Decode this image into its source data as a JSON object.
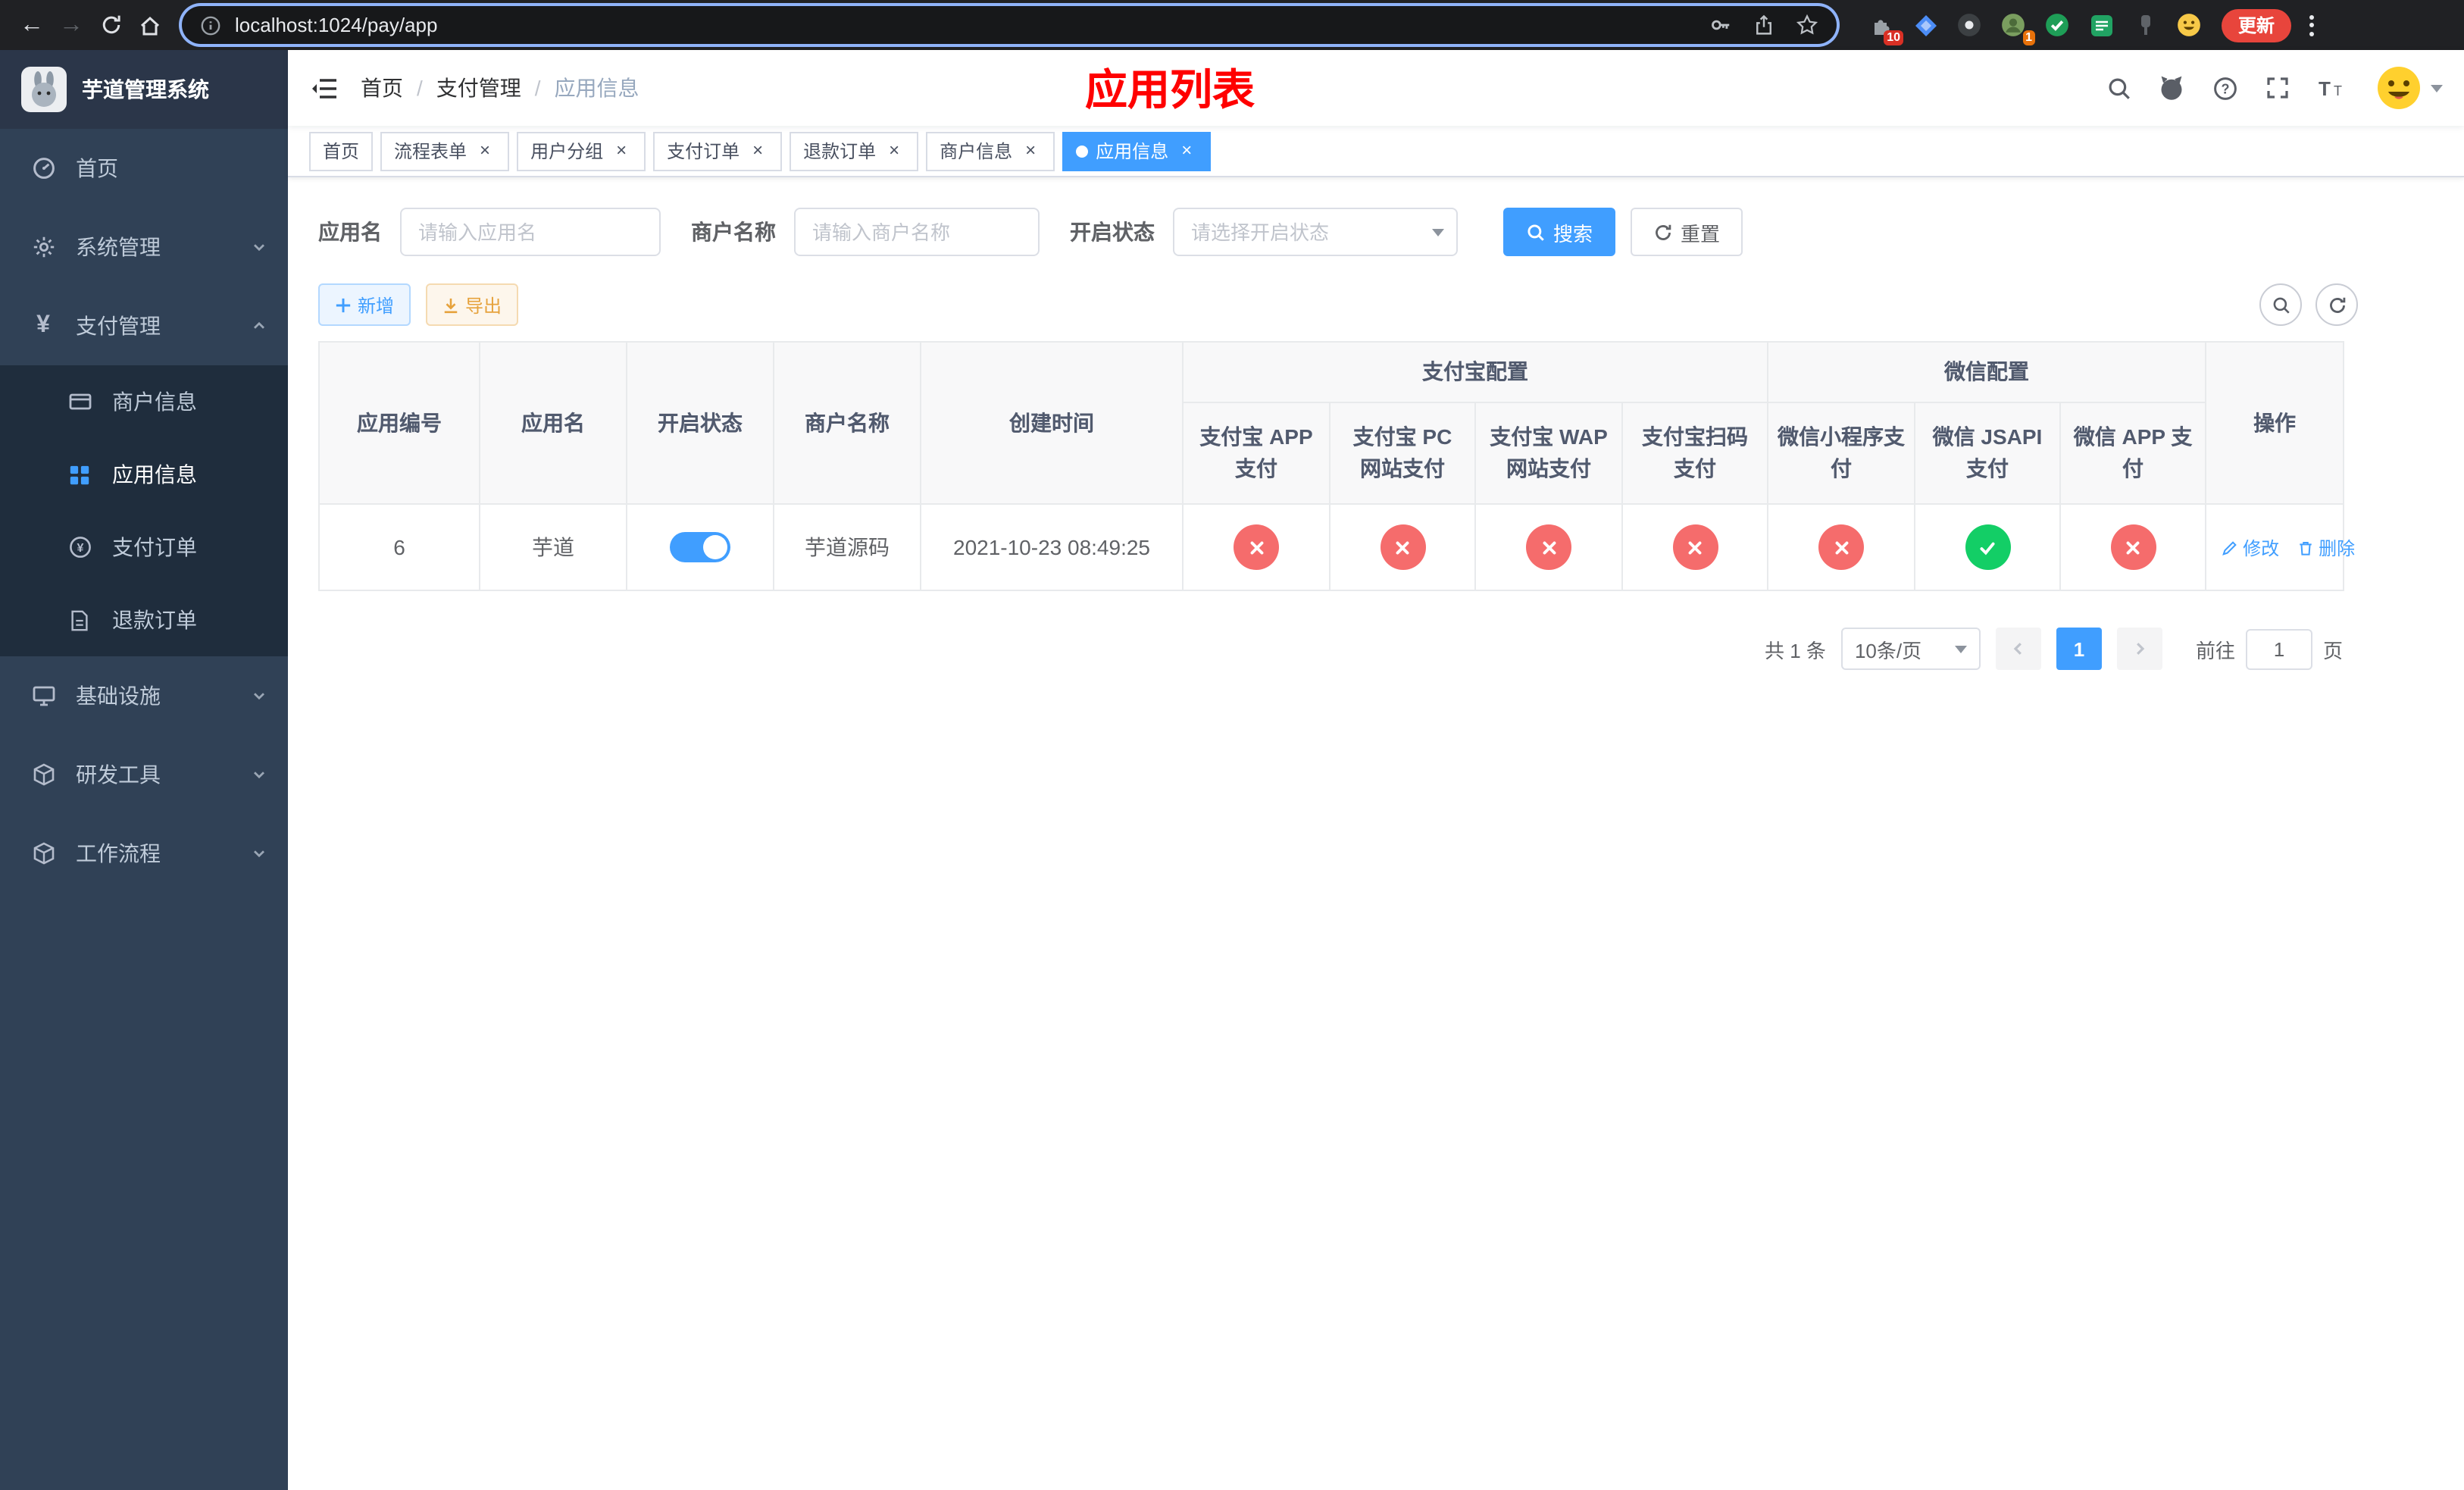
{
  "browser": {
    "url": "localhost:1024/pay/app",
    "update_label": "更新",
    "extensions_badge": "10",
    "profile_badge": "1"
  },
  "sidebar": {
    "title": "芋道管理系统",
    "menu": [
      {
        "label": "首页"
      },
      {
        "label": "系统管理"
      },
      {
        "label": "支付管理"
      },
      {
        "label": "基础设施"
      },
      {
        "label": "研发工具"
      },
      {
        "label": "工作流程"
      }
    ],
    "submenu": [
      {
        "label": "商户信息"
      },
      {
        "label": "应用信息",
        "active": true
      },
      {
        "label": "支付订单"
      },
      {
        "label": "退款订单"
      }
    ]
  },
  "header": {
    "breadcrumb": [
      "首页",
      "支付管理",
      "应用信息"
    ],
    "page_title": "应用列表"
  },
  "tabs": [
    {
      "label": "首页"
    },
    {
      "label": "流程表单"
    },
    {
      "label": "用户分组"
    },
    {
      "label": "支付订单"
    },
    {
      "label": "退款订单"
    },
    {
      "label": "商户信息"
    },
    {
      "label": "应用信息"
    }
  ],
  "filters": {
    "app_name_label": "应用名",
    "app_name_placeholder": "请输入应用名",
    "merchant_label": "商户名称",
    "merchant_placeholder": "请输入商户名称",
    "status_label": "开启状态",
    "status_placeholder": "请选择开启状态",
    "search_label": "搜索",
    "reset_label": "重置"
  },
  "toolbar": {
    "add_label": "新增",
    "export_label": "导出"
  },
  "table": {
    "headers": {
      "app_id": "应用编号",
      "app_name": "应用名",
      "status": "开启状态",
      "merchant": "商户名称",
      "created": "创建时间",
      "alipay_group": "支付宝配置",
      "wechat_group": "微信配置",
      "alipay_app": "支付宝 APP 支付",
      "alipay_pc": "支付宝 PC 网站支付",
      "alipay_wap": "支付宝 WAP 网站支付",
      "alipay_scan": "支付宝扫码支付",
      "wechat_mini": "微信小程序支付",
      "wechat_jsapi": "微信 JSAPI 支付",
      "wechat_app": "微信 APP 支付",
      "actions": "操作"
    },
    "rows": [
      {
        "app_id": "6",
        "app_name": "芋道",
        "status": "on",
        "merchant": "芋道源码",
        "created": "2021-10-23 08:49:25",
        "alipay_app": "disabled",
        "alipay_pc": "disabled",
        "alipay_wap": "disabled",
        "alipay_scan": "disabled",
        "wechat_mini": "disabled",
        "wechat_jsapi": "enabled",
        "wechat_app": "disabled",
        "edit_label": "修改",
        "delete_label": "删除"
      }
    ]
  },
  "pagination": {
    "total_label": "共 1 条",
    "page_size": "10条/页",
    "current_page": "1",
    "goto_label": "前往",
    "goto_value": "1",
    "page_unit": "页"
  },
  "colors": {
    "primary": "#409eff",
    "danger": "#f56c6c",
    "success": "#13ce66",
    "warning": "#e6a23c",
    "sidebar_bg": "#304156",
    "submenu_bg": "#1f2d3d",
    "title_red": "#ff0000"
  }
}
